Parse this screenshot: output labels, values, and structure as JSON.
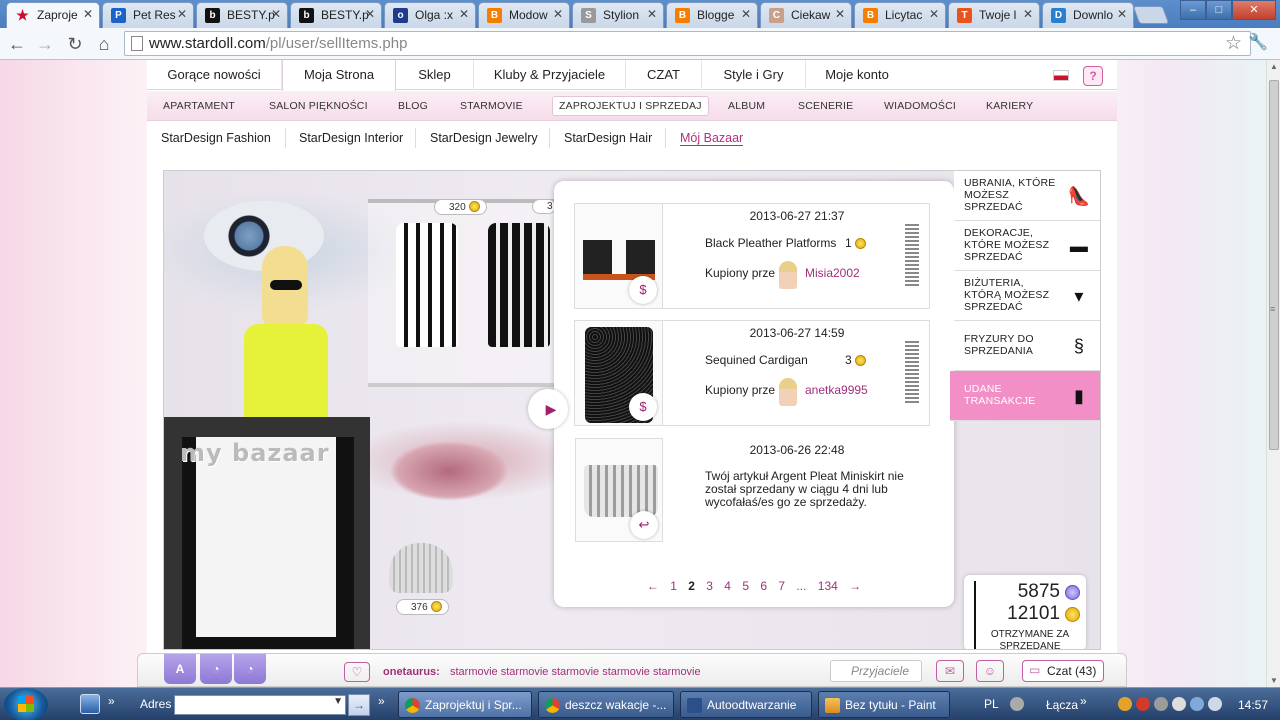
{
  "browser": {
    "tabs": [
      {
        "label": "Zaproje",
        "favicon": "S",
        "color": "#c8102e",
        "active": true
      },
      {
        "label": "Pet Res",
        "favicon": "P",
        "color": "#1a63c9"
      },
      {
        "label": "BESTY.p",
        "favicon": "b",
        "color": "#111111"
      },
      {
        "label": "BESTY.p",
        "favicon": "b",
        "color": "#111111"
      },
      {
        "label": "Olga :x",
        "favicon": "o",
        "color": "#1e3c8c"
      },
      {
        "label": "Modow",
        "favicon": "B",
        "color": "#f57d00"
      },
      {
        "label": "Stylion",
        "favicon": "S",
        "color": "#999999"
      },
      {
        "label": "Blogge",
        "favicon": "B",
        "color": "#f57d00"
      },
      {
        "label": "Ciekaw",
        "favicon": "C",
        "color": "#c9a08a"
      },
      {
        "label": "Licytac",
        "favicon": "B",
        "color": "#f57d00"
      },
      {
        "label": "Twoje l",
        "favicon": "T",
        "color": "#e8541c"
      },
      {
        "label": "Downlo",
        "favicon": "D",
        "color": "#2b7fd0"
      }
    ],
    "url_host": "www.stardoll.com",
    "url_path": "/pl/user/sellItems.php",
    "window_buttons": {
      "minimize": "–",
      "maximize": "□",
      "close": "✕"
    }
  },
  "main_nav": [
    "Gorące nowości",
    "Moja Strona",
    "Sklep",
    "Kluby & Przyjaciele",
    "CZAT",
    "Style i Gry",
    "Moje konto"
  ],
  "main_nav_active": "Moja Strona",
  "sub_nav": [
    "APARTAMENT",
    "SALON PIĘKNOŚCI",
    "BLOG",
    "STARMOVIE",
    "ZAPROJEKTUJ I SPRZEDAJ",
    "ALBUM",
    "SCENERIE",
    "WIADOMOŚCI",
    "KARIERY"
  ],
  "sub_nav_active": "ZAPROJEKTUJ I SPRZEDAJ",
  "third_nav": [
    "StarDesign Fashion",
    "StarDesign Interior",
    "StarDesign Jewelry",
    "StarDesign Hair",
    "Mój Bazaar"
  ],
  "third_nav_active": "Mój Bazaar",
  "help_label": "?",
  "bazaar": {
    "logo_text": "my bazaar",
    "rack_price_1": "320",
    "rack_price_2": "3",
    "skirt_price": "376",
    "transactions": [
      {
        "date": "2013-06-27 21:37",
        "item": "Black Pleather Platforms",
        "qty": "1",
        "buyer_label": "Kupiony prze",
        "buyer": "Misia2002"
      },
      {
        "date": "2013-06-27 14:59",
        "item": "Sequined Cardigan",
        "qty": "3",
        "buyer_label": "Kupiony prze",
        "buyer": "anetka9995"
      },
      {
        "date": "2013-06-26 22:48",
        "message": "Twój artykuł Argent Pleat Miniskirt nie został sprzedany w ciągu 4 dni lub wycofałaś/es go ze sprzedaży."
      }
    ],
    "pager": {
      "prev": "←",
      "pages": [
        "1",
        "2",
        "3",
        "4",
        "5",
        "6",
        "7",
        "...",
        "134"
      ],
      "current": "2",
      "next": "→"
    },
    "side_menu": [
      {
        "label": "UBRANIA, KTÓRE MOŻESZ SPRZEDAĆ",
        "icon": "shoe-icon"
      },
      {
        "label": "DEKORACJE, KTÓRE MOŻESZ SPRZEDAĆ",
        "icon": "sofa-icon"
      },
      {
        "label": "BIŻUTERIA, KTÓRĄ MOŻESZ SPRZEDAĆ",
        "icon": "necklace-icon"
      },
      {
        "label": "FRYZURY DO SPRZEDANIA",
        "icon": "hair-icon"
      },
      {
        "label": "UDANE TRANSAKCJE",
        "icon": "bag-icon",
        "active": true
      }
    ],
    "stats": {
      "stardollars": "5875",
      "coins": "12101",
      "label": "OTRZYMANE ZA SPRZEDANE"
    }
  },
  "footer": {
    "username": "onetaurus:",
    "status": "starmovie starmovie starmovie starmovie starmovie",
    "friends_label": "Przyjaciele",
    "chat_label": "Czat (43)"
  },
  "taskbar": {
    "address_label": "Adres",
    "tasks": [
      {
        "label": "Zaprojektuj i Spr...",
        "active": true
      },
      {
        "label": "deszcz wakacje -..."
      },
      {
        "label": "Autoodtwarzanie"
      },
      {
        "label": "Bez tytułu - Paint"
      }
    ],
    "lang": "PL",
    "network": "Łącza",
    "time": "14:57"
  },
  "colors": {
    "accent": "#a0307a",
    "pink_active": "#f28fc6",
    "coin": "#e0a800"
  }
}
